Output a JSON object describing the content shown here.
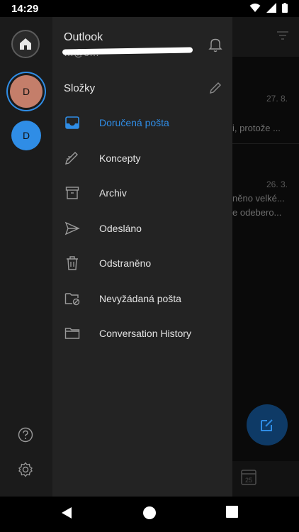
{
  "status_bar": {
    "time": "14:29"
  },
  "background_app": {
    "items": [
      {
        "date": "27. 8.",
        "preview": "i, protože ..."
      },
      {
        "date": "26. 3.",
        "preview_line1": "něno velké...",
        "preview_line2": "e odebero..."
      }
    ],
    "calendar_day": "25"
  },
  "account": {
    "app_name": "Outlook",
    "email_partial": "…@o…",
    "avatars": [
      {
        "initial": "D"
      },
      {
        "initial": "D"
      }
    ]
  },
  "folders": {
    "title": "Složky",
    "items": [
      {
        "label": "Doručená pošta",
        "icon": "inbox-icon",
        "active": true
      },
      {
        "label": "Koncepty",
        "icon": "drafts-icon"
      },
      {
        "label": "Archiv",
        "icon": "archive-icon"
      },
      {
        "label": "Odesláno",
        "icon": "send-icon"
      },
      {
        "label": "Odstraněno",
        "icon": "trash-icon"
      },
      {
        "label": "Nevyžádaná pošta",
        "icon": "junk-icon"
      },
      {
        "label": "Conversation History",
        "icon": "folder-icon"
      }
    ]
  },
  "colors": {
    "accent": "#2f8de6",
    "drawer_bg": "#232323",
    "rail_bg": "#1b1b1b"
  }
}
